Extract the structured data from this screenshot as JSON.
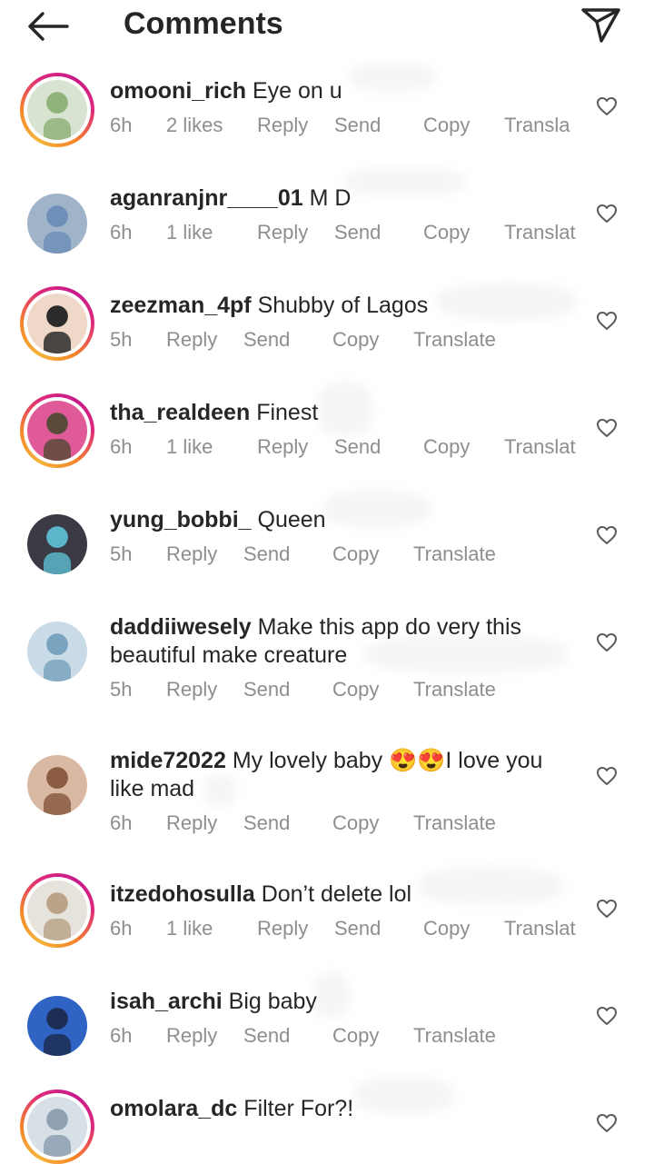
{
  "header": {
    "title": "Comments",
    "back_icon": "arrow-left-icon",
    "share_icon": "paper-plane-icon"
  },
  "comments": [
    {
      "user": "omooni_rich",
      "text": "Eye on u",
      "time": "6h",
      "likes": "2 likes",
      "reply": "Reply",
      "send": "Send",
      "copy": "Copy",
      "translate": "Transla",
      "ring": true,
      "avatar_colors": [
        "#d9e3d2",
        "#8fb37a"
      ]
    },
    {
      "user": "aganranjnr____01",
      "text": "M D",
      "time": "6h",
      "likes": "1 like",
      "reply": "Reply",
      "send": "Send",
      "copy": "Copy",
      "translate": "Translat",
      "ring": false,
      "avatar_colors": [
        "#9fb4c9",
        "#6d8fb8"
      ]
    },
    {
      "user": "zeezman_4pf",
      "text": "Shubby of Lagos",
      "time": "5h",
      "likes": "",
      "reply": "Reply",
      "send": "Send",
      "copy": "Copy",
      "translate": "Translate",
      "ring": true,
      "avatar_colors": [
        "#f0d8c8",
        "#2b2b2b"
      ]
    },
    {
      "user": "tha_realdeen",
      "text": "Finest",
      "time": "6h",
      "likes": "1 like",
      "reply": "Reply",
      "send": "Send",
      "copy": "Copy",
      "translate": "Translat",
      "ring": true,
      "avatar_colors": [
        "#e05a9a",
        "#5a4a3a"
      ]
    },
    {
      "user": "yung_bobbi_",
      "text": "Queen",
      "time": "5h",
      "likes": "",
      "reply": "Reply",
      "send": "Send",
      "copy": "Copy",
      "translate": "Translate",
      "ring": false,
      "avatar_colors": [
        "#3a3a44",
        "#5cb6c9"
      ]
    },
    {
      "user": "daddiiwesely",
      "text": "Make this app do very this beautiful make creature",
      "time": "5h",
      "likes": "",
      "reply": "Reply",
      "send": "Send",
      "copy": "Copy",
      "translate": "Translate",
      "ring": false,
      "avatar_colors": [
        "#c9dbe6",
        "#7aa3bf"
      ]
    },
    {
      "user": "mide72022",
      "text": "My lovely baby 😍😍I love you like mad",
      "time": "6h",
      "likes": "",
      "reply": "Reply",
      "send": "Send",
      "copy": "Copy",
      "translate": "Translate",
      "ring": false,
      "avatar_colors": [
        "#d9b9a3",
        "#8a5a43"
      ]
    },
    {
      "user": "itzedohosulla",
      "text": "Don’t delete lol",
      "time": "6h",
      "likes": "1 like",
      "reply": "Reply",
      "send": "Send",
      "copy": "Copy",
      "translate": "Translat",
      "ring": true,
      "avatar_colors": [
        "#e6e2dc",
        "#b9a48a"
      ]
    },
    {
      "user": "isah_archi",
      "text": "Big baby",
      "time": "6h",
      "likes": "",
      "reply": "Reply",
      "send": "Send",
      "copy": "Copy",
      "translate": "Translate",
      "ring": false,
      "avatar_colors": [
        "#2f63c4",
        "#1c2e55"
      ]
    },
    {
      "user": "omolara_dc",
      "text": "Filter For?!",
      "time": "",
      "likes": "",
      "reply": "",
      "send": "",
      "copy": "",
      "translate": "",
      "ring": true,
      "avatar_colors": [
        "#d7dfe7",
        "#8fa0b0"
      ]
    }
  ]
}
